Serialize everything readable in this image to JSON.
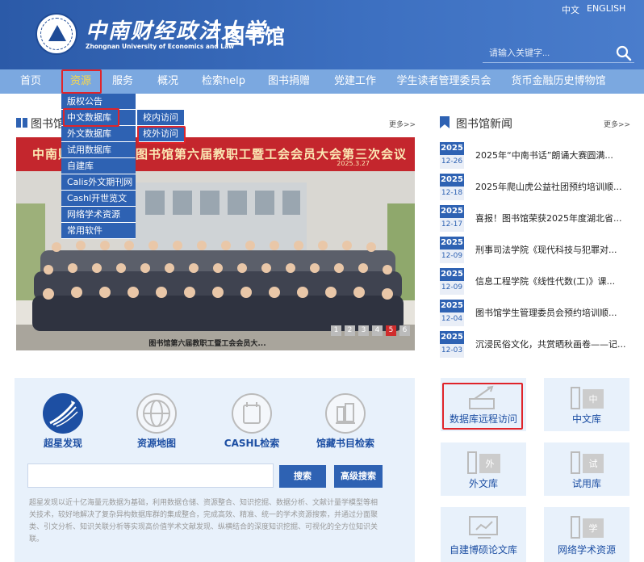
{
  "header": {
    "school_cn": "中南财经政法大学",
    "school_en": "Zhongnan University of Economics and Law",
    "library_title": "图书馆",
    "lang_cn": "中文",
    "lang_en": "ENGLISH",
    "search_placeholder": "请输入关键字..."
  },
  "nav": {
    "items": [
      "首页",
      "资源",
      "服务",
      "概况",
      "检索help",
      "图书捐赠",
      "党建工作",
      "学生读者管理委员会",
      "货币金融历史博物馆"
    ],
    "active_index": 1
  },
  "dropdown": {
    "items": [
      "版权公告",
      "中文数据库",
      "外文数据库",
      "试用数据库",
      "自建库",
      "Calis外文期刊网",
      "Cashl开世览文",
      "网络学术资源",
      "常用软件"
    ],
    "sub_items": [
      "校内访问",
      "校外访问"
    ]
  },
  "sections": {
    "library_news_left_title": "图书馆",
    "news_title": "图书馆新闻",
    "more": "更多>>"
  },
  "slide": {
    "banner_text": "中南财经政法大学图书馆第六届教职工暨工会会员大会第三次会议",
    "banner_date": "2025.3.27",
    "caption": "图书馆第六届教职工暨工会会员大...",
    "pages": [
      "1",
      "2",
      "3",
      "4",
      "5",
      "6"
    ],
    "active_page": 5
  },
  "news": [
    {
      "year": "2025",
      "date": "12-26",
      "title": "2025年“中南书话”朗诵大赛圆满..."
    },
    {
      "year": "2025",
      "date": "12-18",
      "title": "2025年爬山虎公益社团预约培训顺..."
    },
    {
      "year": "2025",
      "date": "12-17",
      "title": "喜报！图书馆荣获2025年度湖北省..."
    },
    {
      "year": "2025",
      "date": "12-09",
      "title": "刑事司法学院《现代科技与犯罪对..."
    },
    {
      "year": "2025",
      "date": "12-09",
      "title": "信息工程学院《线性代数(工)》课..."
    },
    {
      "year": "2025",
      "date": "12-04",
      "title": "图书馆学生管理委员会预约培训顺..."
    },
    {
      "year": "2025",
      "date": "12-03",
      "title": "沉浸民俗文化，共赏晒秋画卷——记..."
    }
  ],
  "quick": {
    "items": [
      "超星发现",
      "资源地图",
      "CASHL检索",
      "馆藏书目检索"
    ],
    "search_btn": "搜索",
    "advanced_btn": "高级搜索",
    "description": "超星发现以近十亿海量元数据为基础，利用数据仓储、资源整合、知识挖掘、数据分析、文献计量学模型等相关技术，较好地解决了复杂异构数据库群的集成整合，完成高效、精准、统一的学术资源搜索，并通过分面聚类、引文分析、知识关联分析等实现高价值学术文献发现、纵横结合的深度知识挖掘、可视化的全方位知识关联。"
  },
  "tiles": [
    {
      "label": "数据库远程访问",
      "icon_text": ""
    },
    {
      "label": "中文库",
      "icon_text": "中"
    },
    {
      "label": "外文库",
      "icon_text": "外"
    },
    {
      "label": "试用库",
      "icon_text": "试"
    },
    {
      "label": "自建博硕论文库",
      "icon_text": ""
    },
    {
      "label": "网络学术资源",
      "icon_text": "学"
    }
  ],
  "colors": {
    "header_blue": "#3c6fc0",
    "nav_blue": "#7ba8e0",
    "dropdown_blue": "#2e62b3",
    "highlight_red": "#e0242a",
    "active_nav": "#fbd94a"
  }
}
